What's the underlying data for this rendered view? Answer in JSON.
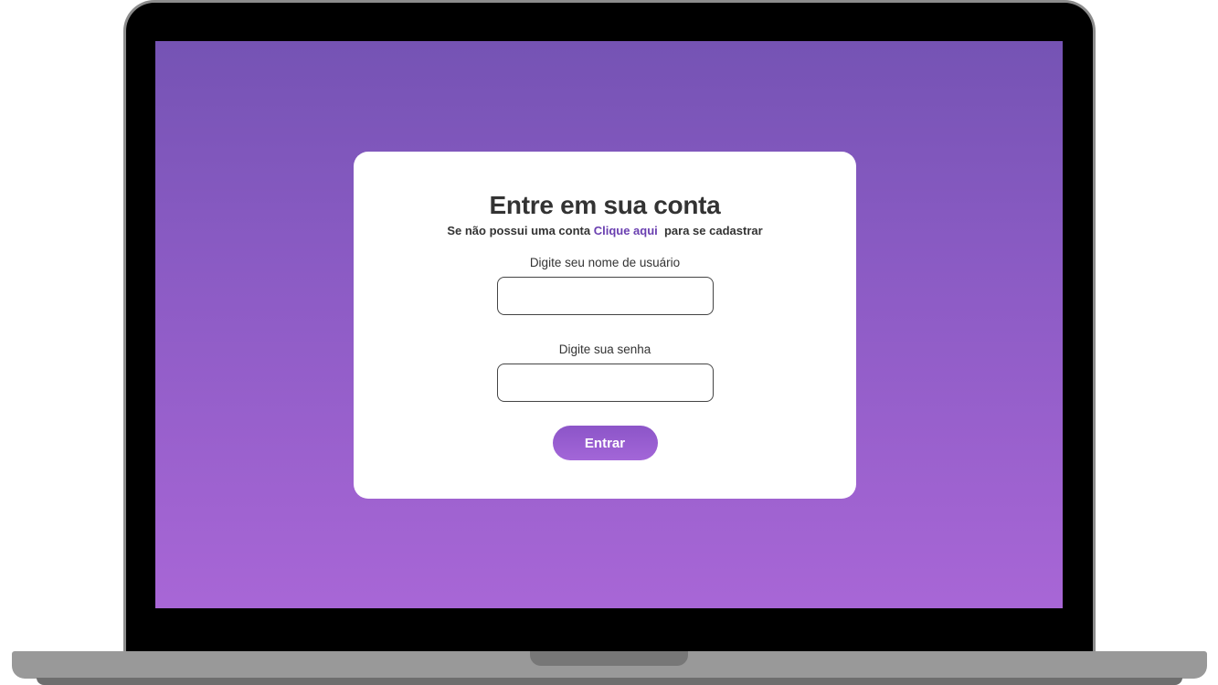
{
  "login": {
    "title": "Entre em sua conta",
    "subtitle_before": "Se não possui uma conta ",
    "signup_link": "Clique aqui",
    "subtitle_after": "  para se cadastrar",
    "username_label": "Digite seu nome de usuário",
    "username_value": "",
    "password_label": "Digite sua senha",
    "password_value": "",
    "submit_label": "Entrar"
  },
  "colors": {
    "gradient_top": "#7553b4",
    "gradient_bottom": "#a866d6",
    "link": "#6a3fb0",
    "button": "#9a5fd1"
  }
}
